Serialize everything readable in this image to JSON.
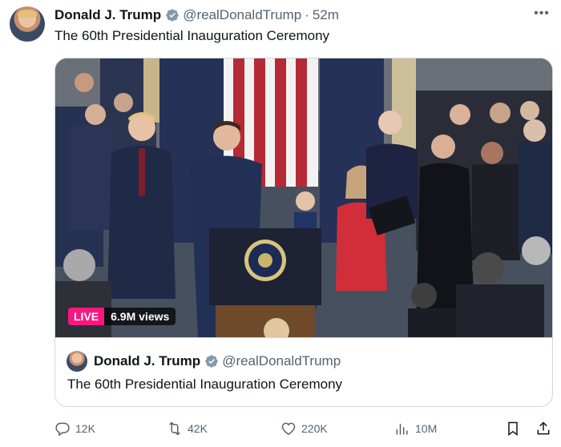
{
  "post": {
    "author_name": "Donald J. Trump",
    "author_handle": "@realDonaldTrump",
    "separator": "·",
    "time": "52m",
    "text": "The 60th Presidential Inauguration Ceremony",
    "more_icon": "more-horizontal-icon"
  },
  "media": {
    "live_label": "LIVE",
    "views_label": "6.9M views",
    "colors": {
      "live": "#f91880"
    }
  },
  "quote": {
    "author_name": "Donald J. Trump",
    "author_handle": "@realDonaldTrump",
    "text": "The 60th Presidential Inauguration Ceremony"
  },
  "actions": {
    "replies": "12K",
    "reposts": "42K",
    "likes": "220K",
    "views": "10M",
    "icons": [
      "reply-icon",
      "repost-icon",
      "like-icon",
      "views-icon",
      "bookmark-icon",
      "share-icon"
    ]
  },
  "colors": {
    "verified": "#1d9bf0",
    "text": "#0f1419",
    "secondary": "#536471",
    "border": "#cfd9de"
  }
}
